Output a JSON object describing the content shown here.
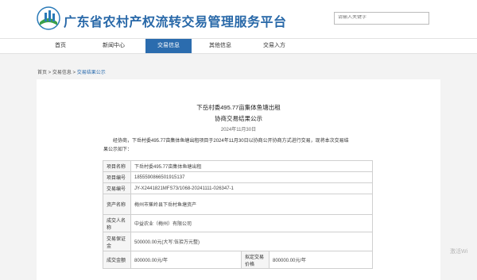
{
  "header": {
    "site_title": "广东省农村产权流转交易管理服务平台",
    "search_placeholder": "请输入关键字"
  },
  "nav": {
    "items": [
      {
        "label": "首页"
      },
      {
        "label": "新闻中心"
      },
      {
        "label": "交易信息"
      },
      {
        "label": "其他信息"
      },
      {
        "label": "交易入方"
      }
    ],
    "active_index": 2
  },
  "breadcrumb": {
    "home": "首页",
    "sep1": " > ",
    "section": "交易信息",
    "sep2": " > ",
    "current": "交易结果公示"
  },
  "document": {
    "title_line1": "下岳村委495.77亩集体鱼塘出租",
    "title_line2": "协商交易结果公示",
    "date": "2024年11月30日",
    "intro_line1": "经协商，下岳村委495.77亩集体鱼塘出租项目于2024年11月30日以协商公开协商方式进行交易，现将本次交易结",
    "intro_line2": "果公示如下："
  },
  "table": {
    "rows": [
      {
        "label": "项目名称",
        "value": "下岳村委495.77亩集体鱼塘出租"
      },
      {
        "label": "项目编号",
        "value": "1855590866501915137"
      },
      {
        "label": "交易编号",
        "value": "JY-X2441821MFS73/1068-20241111-026347-1"
      },
      {
        "label": "资产名称",
        "value": "梅州市蕉岭县下岳村鱼塘资产"
      },
      {
        "label": "成交人名称",
        "value": "中益农业（梅州）有限公司"
      },
      {
        "label": "交易保证金",
        "value": "500000.00元(大写:伍拾万元整)"
      },
      {
        "label": "成交金额",
        "value": "800000.00元/年",
        "label2": "拟定交易价格",
        "value2": "800000.00元/年"
      }
    ]
  },
  "watermark": "激活Wi"
}
